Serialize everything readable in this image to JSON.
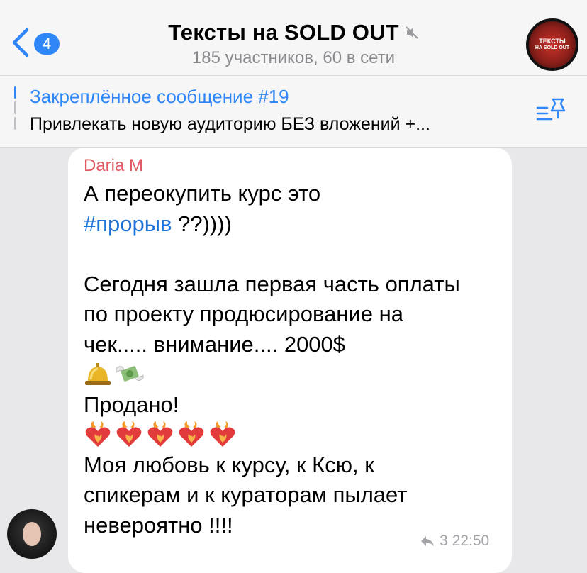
{
  "header": {
    "back_badge": "4",
    "title": "Тексты на SOLD OUT",
    "subtitle": "185 участников, 60 в сети",
    "channel_avatar_line1": "ТЕКСТЫ",
    "channel_avatar_line2": "НА SOLD OUT"
  },
  "pinned": {
    "title": "Закреплённое сообщение #19",
    "text": "Привлекать новую аудиторию БЕЗ вложений +..."
  },
  "message": {
    "sender": "Daria M",
    "line1": "А переокупить курс это",
    "hashtag": "#прорыв",
    "line2_rest": " ??))))",
    "para2_line1": "Сегодня зашла первая часть оплаты",
    "para2_line2": "по проекту продюсирование на",
    "para2_line3": "чек..... внимание.... 2000$",
    "sold": "Продано!",
    "love_line1": "Моя любовь к курсу, к Ксю, к",
    "love_line2": "спикерам и к кураторам пылает",
    "love_line3": "невероятно !!!!",
    "reply_count": "3",
    "time": "22:50"
  },
  "colors": {
    "accent": "#2f86f6",
    "sender": "#e05a63",
    "hashtag": "#1e73d8"
  },
  "icons": [
    "back-chevron-icon",
    "mute-icon",
    "pinned-list-icon",
    "reply-arrow-icon",
    "bell-emoji",
    "money-wings-emoji",
    "heart-fire-emoji"
  ]
}
